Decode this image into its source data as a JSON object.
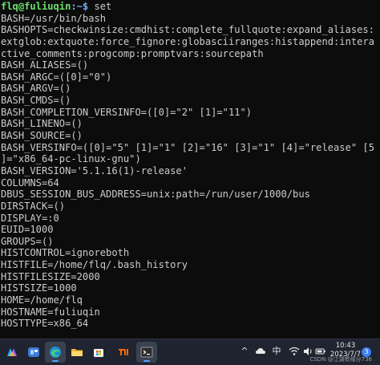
{
  "terminal": {
    "prompt_user": "flq@fuliuqin",
    "prompt_path": ":~$",
    "command": " set",
    "lines": [
      "BASH=/usr/bin/bash",
      "BASHOPTS=checkwinsize:cmdhist:complete_fullquote:expand_aliases:",
      "extglob:extquote:force_fignore:globasciiranges:histappend:intera",
      "ctive_comments:progcomp:promptvars:sourcepath",
      "BASH_ALIASES=()",
      "BASH_ARGC=([0]=\"0\")",
      "BASH_ARGV=()",
      "BASH_CMDS=()",
      "BASH_COMPLETION_VERSINFO=([0]=\"2\" [1]=\"11\")",
      "BASH_LINENO=()",
      "BASH_SOURCE=()",
      "BASH_VERSINFO=([0]=\"5\" [1]=\"1\" [2]=\"16\" [3]=\"1\" [4]=\"release\" [5",
      "]=\"x86_64-pc-linux-gnu\")",
      "BASH_VERSION='5.1.16(1)-release'",
      "COLUMNS=64",
      "DBUS_SESSION_BUS_ADDRESS=unix:path=/run/user/1000/bus",
      "DIRSTACK=()",
      "DISPLAY=:0",
      "EUID=1000",
      "GROUPS=()",
      "HISTCONTROL=ignoreboth",
      "HISTFILE=/home/flq/.bash_history",
      "HISTFILESIZE=2000",
      "HISTSIZE=1000",
      "HOME=/home/flq",
      "HOSTNAME=fuliuqin",
      "HOSTTYPE=x86_64"
    ]
  },
  "taskbar": {
    "apps": [
      {
        "name": "copilot-icon",
        "active": false
      },
      {
        "name": "widgets-icon",
        "active": false
      },
      {
        "name": "edge-browser-icon",
        "active": true
      },
      {
        "name": "file-explorer-icon",
        "active": false
      },
      {
        "name": "microsoft-store-icon",
        "active": false
      },
      {
        "name": "xiaomi-icon",
        "active": false
      },
      {
        "name": "terminal-icon",
        "active": true
      }
    ],
    "tray": {
      "chevron": "^",
      "ime": "中",
      "time": "10:43",
      "date": "2023/7/7",
      "notification_count": "3"
    },
    "watermark": "CSDN @江湖有缘分736"
  },
  "colors": {
    "background": "#0c0c0c",
    "text": "#cccccc",
    "prompt_user": "#6ddf6d",
    "prompt_path": "#6fa8ff"
  }
}
